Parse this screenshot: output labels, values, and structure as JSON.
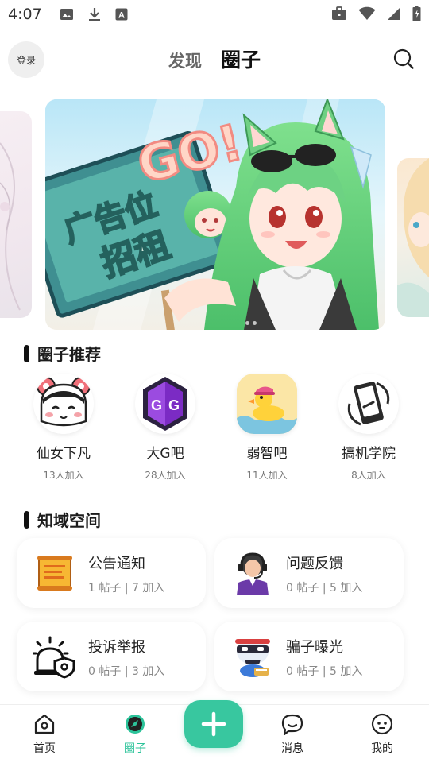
{
  "status_bar": {
    "time": "4:07",
    "left_icons": [
      "image-icon",
      "download-icon",
      "font-icon"
    ],
    "right_icons": [
      "briefcase-icon",
      "wifi-icon",
      "signal-icon",
      "battery-icon"
    ]
  },
  "header": {
    "login_label": "登录",
    "tabs": [
      {
        "label": "发现",
        "active": false
      },
      {
        "label": "圈子",
        "active": true
      }
    ],
    "search_icon": "search-icon"
  },
  "banner": {
    "sign_text_line1": "广告位",
    "sign_text_line2": "招租",
    "sign_go_text": "GO!"
  },
  "sections": {
    "recommend_title": "圈子推荐",
    "zone_title": "知域空间"
  },
  "circles": [
    {
      "name": "仙女下凡",
      "count": "13人加入",
      "icon": "fairy-avatar-icon"
    },
    {
      "name": "大G吧",
      "count": "28人加入",
      "icon": "gg-logo-icon"
    },
    {
      "name": "弱智吧",
      "count": "11人加入",
      "icon": "duck-icon"
    },
    {
      "name": "搞机学院",
      "count": "8人加入",
      "icon": "phone-icon"
    }
  ],
  "zones": [
    {
      "title": "公告通知",
      "posts": "1 帖子",
      "joined": "7 加入",
      "icon": "scroll-icon"
    },
    {
      "title": "问题反馈",
      "posts": "0 帖子",
      "joined": "5 加入",
      "icon": "support-agent-icon"
    },
    {
      "title": "投诉举报",
      "posts": "0 帖子",
      "joined": "3 加入",
      "icon": "alarm-shield-icon"
    },
    {
      "title": "骗子曝光",
      "posts": "0 帖子",
      "joined": "5 加入",
      "icon": "masked-robot-icon"
    }
  ],
  "meta_separator": "|",
  "bottom_nav": [
    {
      "label": "首页",
      "icon": "home-icon",
      "active": false
    },
    {
      "label": "圈子",
      "icon": "compass-icon",
      "active": true
    },
    {
      "label": "消息",
      "icon": "chat-icon",
      "active": false
    },
    {
      "label": "我的",
      "icon": "profile-face-icon",
      "active": false
    }
  ],
  "colors": {
    "accent": "#38c79f",
    "active_text": "#2cc39a",
    "muted_text": "#888888"
  }
}
